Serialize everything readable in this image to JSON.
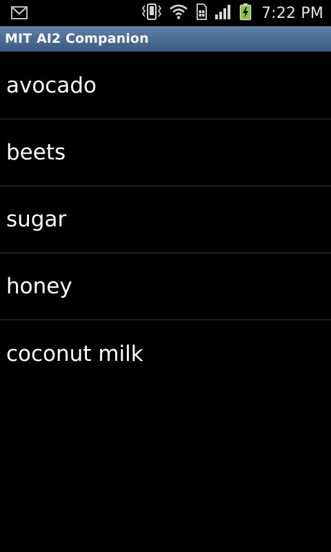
{
  "status_bar": {
    "time": "7:22 PM",
    "icons": [
      "gmail-icon",
      "vibrate-icon",
      "wifi-icon",
      "sim-icon",
      "signal-icon",
      "battery-charging-icon"
    ]
  },
  "app": {
    "title": "MIT AI2 Companion"
  },
  "list": {
    "items": [
      {
        "label": "avocado"
      },
      {
        "label": "beets"
      },
      {
        "label": "sugar"
      },
      {
        "label": "honey"
      },
      {
        "label": "coconut milk"
      }
    ]
  },
  "colors": {
    "background": "#000000",
    "title_bar": "#4b6a92",
    "divider": "#3a3a3a",
    "battery_green": "#8cc63f"
  }
}
